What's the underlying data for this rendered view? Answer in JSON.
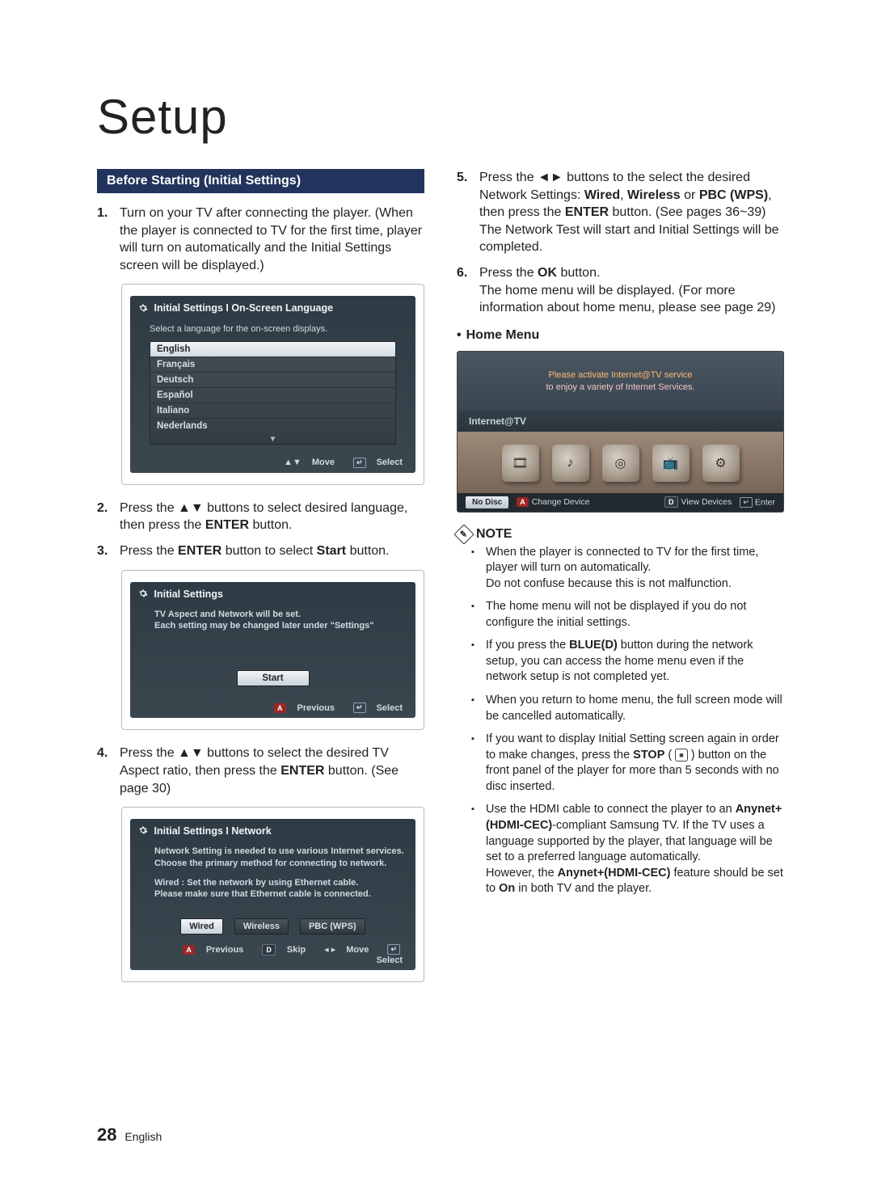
{
  "page_title": "Setup",
  "section_header": "Before Starting (Initial Settings)",
  "steps_left": {
    "s1": {
      "num": "1.",
      "text_a": "Turn on your TV after connecting the player. (When the player is connected to TV for the first time, player will turn on automatically and the Initial Settings screen will be displayed.)"
    },
    "s2": {
      "num": "2.",
      "text_a": "Press the ▲▼ buttons to select desired language, then press the ",
      "bold_a": "ENTER",
      "text_b": " button."
    },
    "s3": {
      "num": "3.",
      "text_a": "Press the ",
      "bold_a": "ENTER",
      "text_b": " button to select ",
      "bold_b": "Start",
      "text_c": " button."
    },
    "s4": {
      "num": "4.",
      "text_a": "Press the ▲▼ buttons to select the desired TV Aspect ratio, then press the ",
      "bold_a": "ENTER",
      "text_b": " button. (See page 30)"
    }
  },
  "steps_right": {
    "s5": {
      "num": "5.",
      "text_a": "Press the ◄► buttons to the select the desired Network Settings: ",
      "bold_a": "Wired",
      "sep_a": ", ",
      "bold_b": "Wireless",
      "sep_b": " or ",
      "bold_c": "PBC (WPS)",
      "text_b": ", then press the ",
      "bold_d": "ENTER",
      "text_c": " button. (See pages 36~39)",
      "text_d": "The Network Test will start and Initial Settings will be completed."
    },
    "s6": {
      "num": "6.",
      "text_a": "Press the ",
      "bold_a": "OK",
      "text_b": " button.",
      "text_c": "The home menu will be displayed. (For more information about home menu, please see page 29)"
    }
  },
  "home_bullet": "Home Menu",
  "osd1": {
    "title": "Initial Settings I On-Screen Language",
    "msg": "Select a language for the on-screen displays.",
    "langs": [
      "English",
      "Français",
      "Deutsch",
      "Español",
      "Italiano",
      "Nederlands"
    ],
    "footer_move": "Move",
    "footer_select": "Select"
  },
  "osd2": {
    "title": "Initial Settings",
    "msg1": "TV Aspect and Network will be set.",
    "msg2": "Each setting may be changed later under \"Settings\"",
    "start": "Start",
    "prev": "Previous",
    "select": "Select"
  },
  "osd3": {
    "title": "Initial Settings I Network",
    "msg1": "Network Setting is needed to use various Internet services.",
    "msg2": "Choose the primary method for connecting to network.",
    "msg3": "Wired : Set the network by using Ethernet cable.",
    "msg4": "Please make sure that Ethernet cable is connected.",
    "btns": [
      "Wired",
      "Wireless",
      "PBC (WPS)"
    ],
    "prev": "Previous",
    "skip": "Skip",
    "move": "Move",
    "select": "Select"
  },
  "home_osd": {
    "line1": "Please activate Internet@TV service",
    "line2": "to enjoy a variety of Internet Services.",
    "tag": "Internet@TV",
    "status": "No Disc",
    "change": "Change Device",
    "view": "View Devices",
    "enter": "Enter"
  },
  "note_label": "NOTE",
  "notes": {
    "n1_a": "When the player is connected to TV for the first time, player will turn on automatically.",
    "n1_b": "Do not confuse because this is not malfunction.",
    "n2": "The home menu will not be displayed if you do not configure the initial settings.",
    "n3_a": "If you press the ",
    "n3_bold": "BLUE(D)",
    "n3_b": " button during the network setup, you can access the home menu even if the network setup is not completed yet.",
    "n4": "When you return to home menu, the full screen mode will be cancelled automatically.",
    "n5_a": "If you want to display Initial Setting screen again in order to make changes, press the ",
    "n5_bold": "STOP",
    "n5_b": " ( ",
    "n5_c": " ) button on the front panel of the player for more than 5 seconds with no disc inserted.",
    "n6_a": "Use the HDMI cable to connect the player to an ",
    "n6_bold1": "Anynet+(HDMI-CEC)",
    "n6_b": "-compliant Samsung TV. If the TV uses a language supported by the player, that language will be set to a preferred language automatically.",
    "n6_c": "However, the ",
    "n6_bold2": "Anynet+(HDMI-CEC)",
    "n6_d": " feature should be set to ",
    "n6_bold3": "On",
    "n6_e": " in both TV and the player."
  },
  "page_footer": {
    "num": "28",
    "lang": "English"
  }
}
